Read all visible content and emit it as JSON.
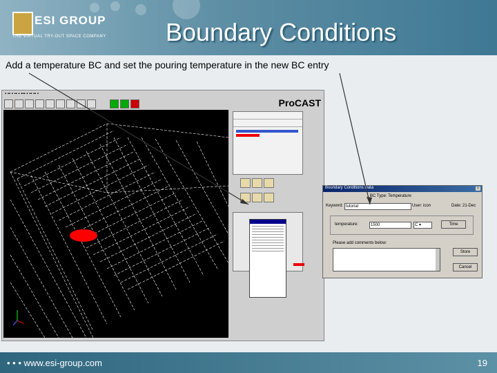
{
  "slide": {
    "logo_text": "ESI GROUP",
    "logo_subtitle": "THE VIRTUAL TRY-OUT SPACE COMPANY",
    "title": "Boundary Conditions",
    "caption": "Add a temperature BC and set the pouring temperature in the new BC entry",
    "footer_url": "• • • www.esi-group.com",
    "page_number": "19"
  },
  "procast": {
    "brand": "ProCAST"
  },
  "dialog": {
    "title": "Boundary Conditions Data",
    "bc_type_label": "BC Type: Temperature",
    "keyword_label": "Keyword:",
    "keyword_value": "tutorial",
    "user_label": "User: icon",
    "date_label": "Date: 21-Dec",
    "temperature_label": "temperature:",
    "temperature_value": "1500",
    "unit_value": "C",
    "time_button": "Time",
    "comments_label": "Please add comments below:",
    "store_button": "Store",
    "cancel_button": "Cancel"
  }
}
